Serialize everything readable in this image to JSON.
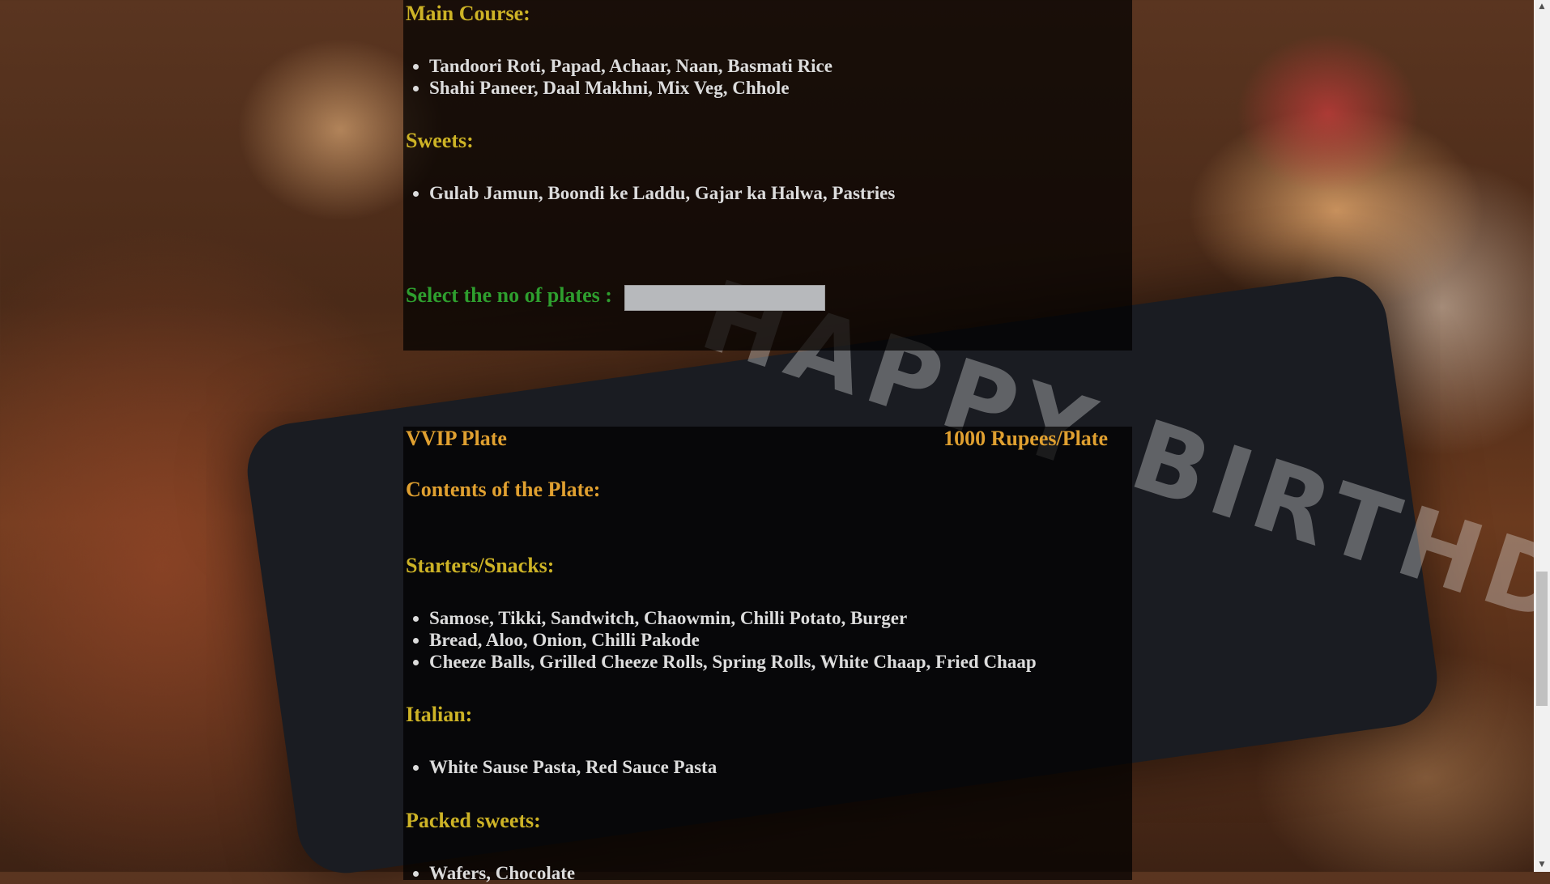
{
  "standard_plate": {
    "main_course": {
      "heading": "Main Course:",
      "items": [
        "Tandoori Roti, Papad, Achaar, Naan, Basmati Rice",
        "Shahi Paneer, Daal Makhni, Mix Veg, Chhole"
      ]
    },
    "sweets": {
      "heading": "Sweets:",
      "items": [
        "Gulab Jamun, Boondi ke Laddu, Gajar ka Halwa, Pastries"
      ]
    },
    "plates_label": "Select the no of plates :",
    "plates_value": ""
  },
  "vvip_plate": {
    "name": "VVIP Plate",
    "price": "1000 Rupees/Plate",
    "contents_heading": "Contents of the Plate:",
    "starters": {
      "heading": "Starters/Snacks:",
      "items": [
        "Samose, Tikki, Sandwitch, Chaowmin, Chilli Potato, Burger",
        "Bread, Aloo, Onion, Chilli Pakode",
        "Cheeze Balls, Grilled Cheeze Rolls, Spring Rolls, White Chaap, Fried Chaap"
      ]
    },
    "italian": {
      "heading": "Italian:",
      "items": [
        "White Sause Pasta, Red Sauce Pasta"
      ]
    },
    "packed_sweets": {
      "heading": "Packed sweets:",
      "items": [
        "Wafers, Chocolate"
      ]
    }
  },
  "background_text": "HAPPY BIRTHDAY",
  "icons": {
    "scroll_up": "triangle-up-icon",
    "scroll_down": "triangle-down-icon"
  }
}
